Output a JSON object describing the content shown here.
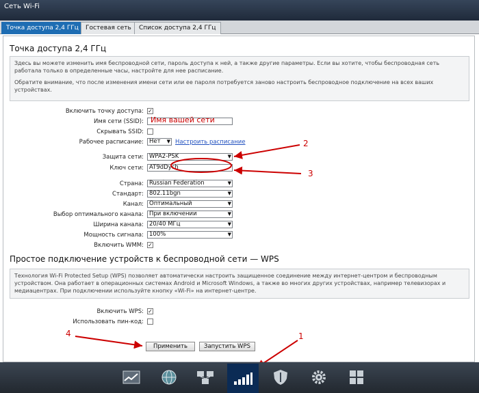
{
  "window": {
    "title": "Сеть Wi-Fi"
  },
  "tabs": [
    {
      "label": "Точка доступа 2,4 ГГц"
    },
    {
      "label": "Гостевая сеть"
    },
    {
      "label": "Список доступа 2,4 ГГц"
    }
  ],
  "section1": {
    "heading": "Точка доступа 2,4 ГГц",
    "info": [
      "Здесь вы можете изменить имя беспроводной сети, пароль доступа к ней, а также другие параметры. Если вы хотите, чтобы беспроводная сеть работала только в определенные часы, настройте для нее расписание.",
      "Обратите внимание, что после изменения имени сети или ее пароля потребуется заново настроить беспроводное подключение на всех ваших устройствах."
    ]
  },
  "form": {
    "enable_ap": {
      "label": "Включить точку доступа:",
      "checked": true
    },
    "ssid": {
      "label": "Имя сети (SSID):",
      "overlay": "Имя вашей сети"
    },
    "hide_ssid": {
      "label": "Скрывать SSID:",
      "checked": false
    },
    "schedule": {
      "label": "Рабочее расписание:",
      "value": "Нет",
      "link": "Настроить расписание"
    },
    "security": {
      "label": "Защита сети:",
      "value": "WPA2-PSK"
    },
    "key": {
      "label": "Ключ сети:",
      "value": "AT9dDych"
    },
    "country": {
      "label": "Страна:",
      "value": "Russian Federation"
    },
    "standard": {
      "label": "Стандарт:",
      "value": "802.11bgn"
    },
    "channel": {
      "label": "Канал:",
      "value": "Оптимальный"
    },
    "channel_select": {
      "label": "Выбор оптимального канала:",
      "value": "При включении"
    },
    "width": {
      "label": "Ширина канала:",
      "value": "20/40 МГц"
    },
    "power": {
      "label": "Мощность сигнала:",
      "value": "100%"
    },
    "wmm": {
      "label": "Включить WMM:",
      "checked": true
    }
  },
  "section2": {
    "heading": "Простое подключение устройств к беспроводной сети — WPS",
    "info": "Технология Wi-Fi Protected Setup (WPS) позволяет автоматически настроить защищенное соединение между интернет-центром и беспроводным устройством. Она работает в операционных системах Android и Microsoft Windows, а также во многих других устройствах, например телевизорах и медиацентрах. При подключении используйте кнопку «Wi-Fi» на интернет-центре.",
    "enable_wps": {
      "label": "Включить WPS:",
      "checked": true
    },
    "use_pin": {
      "label": "Использовать пин-код:",
      "checked": false
    }
  },
  "buttons": {
    "apply": "Применить",
    "start_wps": "Запустить WPS"
  },
  "annotations": {
    "n1": "1",
    "n2": "2",
    "n3": "3",
    "n4": "4"
  },
  "dock": {
    "icons": [
      "chart-icon",
      "globe-icon",
      "network-icon",
      "wifi-signal-icon",
      "shield-icon",
      "gear-icon",
      "apps-grid-icon"
    ],
    "active": "wifi-signal-icon"
  },
  "colors": {
    "annotation": "#cc0000",
    "tab_active": "#1e6db3",
    "dock_active": "#0b2b55"
  }
}
